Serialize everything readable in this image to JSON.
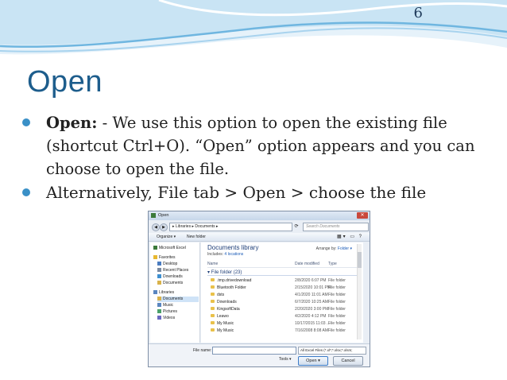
{
  "slide": {
    "page_number": "6",
    "title": "Open",
    "bullet1_bold": "Open:",
    "bullet1_text": " - We use this option to open the existing file (shortcut Ctrl+O). “Open” option appears and you can choose to open the file.",
    "bullet2_text": "Alternatively, File tab > Open > choose the file"
  },
  "colors": {
    "accent": "#3a90c7",
    "title": "#1d5d8c"
  },
  "dialog": {
    "title": "Open",
    "address": "▸ Libraries ▸ Documents ▸",
    "search_placeholder": "Search Documents",
    "toolbar": {
      "organize": "Organize ▾",
      "new_folder": "New folder"
    },
    "nav": [
      {
        "label": "Microsoft Excel",
        "icon": "excel-icon",
        "indent": false
      },
      {
        "label": "Favorites",
        "icon": "star-icon",
        "indent": false
      },
      {
        "label": "Desktop",
        "icon": "desktop-icon",
        "indent": true
      },
      {
        "label": "Recent Places",
        "icon": "recent-icon",
        "indent": true
      },
      {
        "label": "Downloads",
        "icon": "downloads-icon",
        "indent": true
      },
      {
        "label": "Documents",
        "icon": "documents-icon",
        "indent": true
      },
      {
        "label": "Libraries",
        "icon": "library-icon",
        "indent": false
      },
      {
        "label": "Documents",
        "icon": "documents-icon",
        "indent": true,
        "selected": true
      },
      {
        "label": "Music",
        "icon": "music-icon",
        "indent": true
      },
      {
        "label": "Pictures",
        "icon": "pictures-icon",
        "indent": true
      },
      {
        "label": "Videos",
        "icon": "videos-icon",
        "indent": true
      }
    ],
    "library_heading": "Documents library",
    "includes_label": "Includes: ",
    "includes_link": "4 locations",
    "arrange_label": "Arrange by: ",
    "arrange_value": "Folder ▾",
    "columns": {
      "name": "Name",
      "date": "Date modified",
      "type": "Type"
    },
    "group_header": "▾ File folder (23)",
    "rows": [
      {
        "name": ".tmp.drivedownload",
        "date": "2/8/2020 6:07 PM",
        "type": "File folder"
      },
      {
        "name": "Bluetooth Folder",
        "date": "2/15/2020 10:01 PM",
        "type": "File folder"
      },
      {
        "name": "dsts",
        "date": "4/1/2020 11:01 AM",
        "type": "File folder"
      },
      {
        "name": "Downloads",
        "date": "6/7/2020 10:25 AM",
        "type": "File folder"
      },
      {
        "name": "KingsoftData",
        "date": "2/20/2020 3:00 PM",
        "type": "File folder"
      },
      {
        "name": "Leawo",
        "date": "4/2/2020 4:12 PM",
        "type": "File folder"
      },
      {
        "name": "My Music",
        "date": "10/17/2015 11:03 ...",
        "type": "File folder"
      },
      {
        "name": "My Music",
        "date": "7/16/2008 8:08 AM",
        "type": "File folder"
      }
    ],
    "file_name_label": "File name:",
    "file_name_value": "",
    "filter": "All Excel Files (*.xl*;*.xlsx;*.xlsm;",
    "tools": "Tools ▾",
    "open": "Open ▾",
    "cancel": "Cancel"
  }
}
